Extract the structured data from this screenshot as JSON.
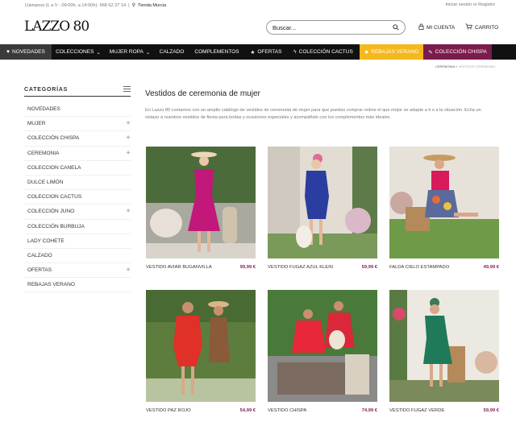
{
  "topbar": {
    "contact": "Llámanos (L a V - 09:00h. a 14:00h): 968 62 27 14",
    "store": "Tienda Murcia",
    "account_links": "Iniciar sesión or Registro"
  },
  "header": {
    "logo": "LAZZO 80",
    "search_placeholder": "Buscar...",
    "account_label": "MI CUENTA",
    "cart_label": "CARRITO"
  },
  "nav": [
    {
      "label": "NOVEDADES",
      "icon": "heart-icon"
    },
    {
      "label": "COLECCIONES",
      "icon": "chevron-down-icon"
    },
    {
      "label": "MUJER ROPA",
      "icon": "chevron-down-icon"
    },
    {
      "label": "CALZADO"
    },
    {
      "label": "COMPLEMENTOS"
    },
    {
      "label": "OFERTAS",
      "icon": "star-icon"
    },
    {
      "label": "COLECCIÓN CACTUS",
      "icon": "bolt-icon"
    },
    {
      "label": "REBAJAS VERANO",
      "icon": "sun-icon"
    },
    {
      "label": "COLECCIÓN CHISPA",
      "icon": "wand-icon"
    }
  ],
  "colors": {
    "nav_bg": "#111111",
    "rebajas": "#f5b81e",
    "chispa": "#7b1c4c",
    "price": "#8a1f5a"
  },
  "breadcrumb": {
    "parent": "CEREMONIA",
    "separator": "»",
    "current": "VESTIDOS CEREMONIA"
  },
  "sidebar": {
    "title": "CATEGORÍAS",
    "items": [
      {
        "label": "NOVEDADES",
        "expandable": false
      },
      {
        "label": "MUJER",
        "expandable": true
      },
      {
        "label": "COLECCIÓN CHISPA",
        "expandable": true
      },
      {
        "label": "CEREMONIA",
        "expandable": true
      },
      {
        "label": "COLECCION CANELA",
        "expandable": false
      },
      {
        "label": "DULCE LIMÓN",
        "expandable": false
      },
      {
        "label": "COLECCION CACTUS",
        "expandable": false
      },
      {
        "label": "COLECCIÓN JUNO",
        "expandable": true
      },
      {
        "label": "COLECCIÓN BURBUJA",
        "expandable": false
      },
      {
        "label": "LADY COHETE",
        "expandable": false
      },
      {
        "label": "CALZADO",
        "expandable": false
      },
      {
        "label": "OFERTAS",
        "expandable": true
      },
      {
        "label": "REBAJAS VERANO",
        "expandable": false
      }
    ]
  },
  "main": {
    "title": "Vestidos de ceremonia de mujer",
    "description": "En Lazzo 80 contamos con un amplio catálogo de vestidos de ceremonia de mujer para que puedas comprar online el que mejor se adapte a ti o a la situación. Echa un vistazo a nuestros vestidos de fiesta para bodas y ocasiones especiales y acompáñalo con los complementos más ideales."
  },
  "products": [
    {
      "name": "VESTIDO AVIAR BUGANVILLA",
      "price": "99,99 €"
    },
    {
      "name": "VESTIDO FUGAZ AZUL KLEIN",
      "price": "59,99 €"
    },
    {
      "name": "FALDA CIELO ESTAMPADO",
      "price": "49,99 €"
    },
    {
      "name": "VESTIDO PAZ ROJO",
      "price": "54,99 €"
    },
    {
      "name": "VESTIDO CHISPA",
      "price": "74,99 €"
    },
    {
      "name": "VESTIDO FUGAZ VERDE",
      "price": "59,99 €"
    }
  ]
}
